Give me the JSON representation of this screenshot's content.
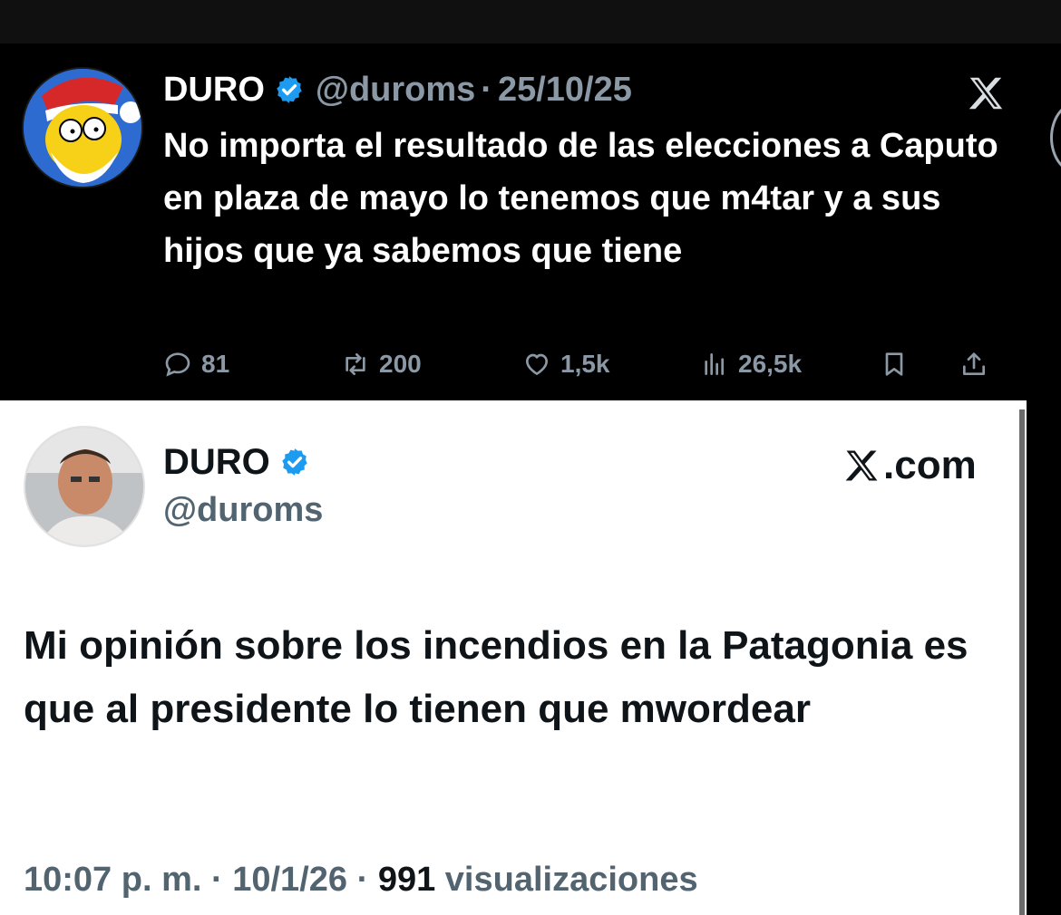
{
  "top_tweet": {
    "author_name": "DURO",
    "handle": "@duroms",
    "separator": "·",
    "date": "25/10/25",
    "text": "No importa el resultado de las elecciones a Caputo en plaza de mayo lo tenemos que m4tar y a sus hijos que ya sabemos que tiene",
    "stats": {
      "replies": "81",
      "retweets": "200",
      "likes": "1,5k",
      "views": "26,5k"
    },
    "icons": [
      "verified-badge-icon",
      "x-logo-icon",
      "reply-icon",
      "retweet-icon",
      "like-icon",
      "views-icon",
      "bookmark-icon",
      "share-icon"
    ]
  },
  "bottom_tweet": {
    "author_name": "DURO",
    "handle": "@duroms",
    "site_label": ".com",
    "text": "Mi opinión sobre los incendios en la Patagonia es que al presidente lo tienen que mwordear",
    "time": "10:07",
    "time_suffix": "p. m.",
    "separator": "·",
    "date": "10/1/26",
    "views_count": "991",
    "views_label": "visualizaciones"
  },
  "colors": {
    "verified_blue": "#1d9bf0",
    "dark_secondary": "#8b98a5",
    "light_secondary": "#536471",
    "light_text": "#0f1419"
  }
}
